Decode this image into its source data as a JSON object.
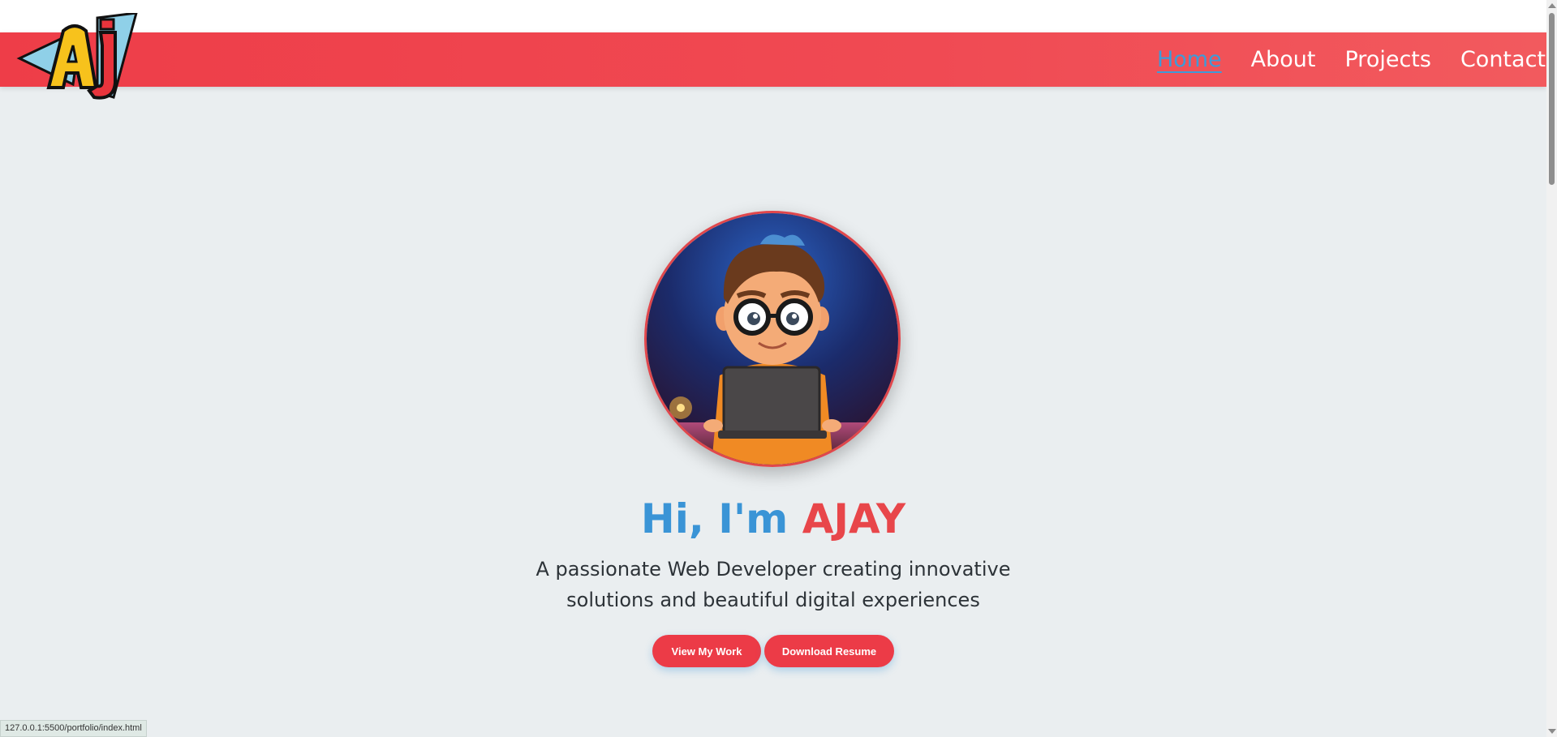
{
  "logo": {
    "icon": "aj-logo-icon",
    "letters": "AJ"
  },
  "nav": {
    "items": [
      {
        "label": "Home",
        "active": true
      },
      {
        "label": "About",
        "active": false
      },
      {
        "label": "Projects",
        "active": false
      },
      {
        "label": "Contact",
        "active": false
      }
    ]
  },
  "hero": {
    "avatar_icon": "cartoon-developer-avatar",
    "greeting": "Hi, I'm ",
    "name": "AJAY",
    "subtitle": "A passionate Web Developer creating innovative solutions and beautiful digital experiences",
    "primary_button": "View My Work",
    "secondary_button": "Download Resume"
  },
  "status_bar": {
    "url": "127.0.0.1:5500/portfolio/index.html"
  },
  "colors": {
    "nav_bg": "#ee3d48",
    "accent_blue": "#3a94d6",
    "accent_red": "#e8464a",
    "page_bg": "#eaeef0"
  }
}
